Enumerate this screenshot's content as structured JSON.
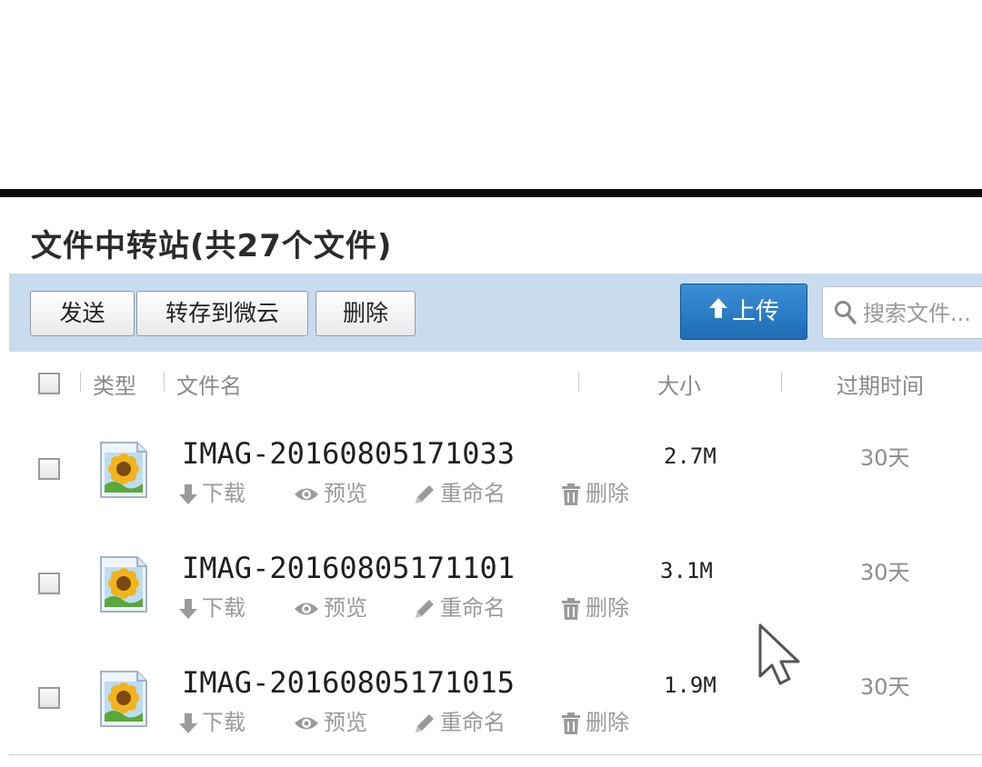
{
  "panel": {
    "title": "文件中转站(共27个文件)"
  },
  "toolbar": {
    "send_label": "发送",
    "save_to_weiyun_label": "转存到微云",
    "delete_label": "删除",
    "upload_label": "上传",
    "search_placeholder": "搜索文件..."
  },
  "list_header": {
    "type": "类型",
    "name": "文件名",
    "size": "大小",
    "expire": "过期时间"
  },
  "row_actions": {
    "download": "下载",
    "preview": "预览",
    "rename": "重命名",
    "delete": "删除"
  },
  "files": [
    {
      "name": "IMAG-20160805171033",
      "size": "2.7M",
      "expire": "30天"
    },
    {
      "name": "IMAG-20160805171101",
      "size": "3.1M",
      "expire": "30天"
    },
    {
      "name": "IMAG-20160805171015",
      "size": "1.9M",
      "expire": "30天"
    }
  ],
  "colors": {
    "toolbar_bg": "#c9dcef",
    "upload_button": "#2a7ec8",
    "action_text": "#9a9a9a"
  },
  "icons": [
    "up-arrow-icon",
    "search-icon",
    "image-file-icon",
    "download-icon",
    "eye-icon",
    "pencil-icon",
    "trash-icon",
    "mouse-cursor-icon"
  ]
}
